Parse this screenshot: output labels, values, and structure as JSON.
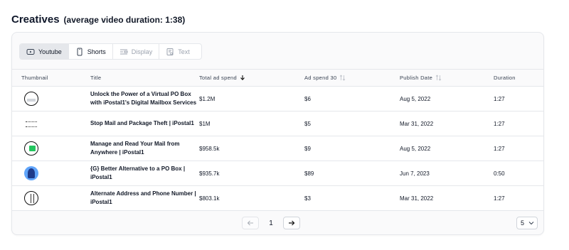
{
  "heading": {
    "title": "Creatives",
    "subtitle": "(average video duration: 1:38)"
  },
  "tabs": [
    {
      "label": "Youtube",
      "icon": "youtube-icon",
      "state": "active"
    },
    {
      "label": "Shorts",
      "icon": "phone-icon",
      "state": "enabled"
    },
    {
      "label": "Display",
      "icon": "display-icon",
      "state": "disabled"
    },
    {
      "label": "Text",
      "icon": "text-icon",
      "state": "disabled"
    }
  ],
  "table": {
    "headers": [
      "Thumbnail",
      "Title",
      "Total ad spend",
      "Ad spend 30",
      "Publish Date",
      "Duration"
    ],
    "rows": [
      {
        "title": "Unlock the Power of a Virtual PO Box with iPostal1's Digital Mailbox Services",
        "spend": "$1.2M",
        "spend30": "$6",
        "date": "Aug 5, 2022",
        "duration": "1:27"
      },
      {
        "title": "Stop Mail and Package Theft | iPostal1",
        "spend": "$1M",
        "spend30": "$5",
        "date": "Mar 31, 2022",
        "duration": "1:27"
      },
      {
        "title": "Manage and Read Your Mail from Anywhere | iPostal1",
        "spend": "$958.5k",
        "spend30": "$9",
        "date": "Aug 5, 2022",
        "duration": "1:27"
      },
      {
        "title": "{G} Better Alternative to a PO Box | iPostal1",
        "spend": "$935.7k",
        "spend30": "$89",
        "date": "Jun 7, 2023",
        "duration": "0:50"
      },
      {
        "title": "Alternate Address and Phone Number | iPostal1",
        "spend": "$803.1k",
        "spend30": "$3",
        "date": "Mar 31, 2022",
        "duration": "1:27"
      }
    ]
  },
  "pagination": {
    "page": "1",
    "page_size": "5"
  }
}
